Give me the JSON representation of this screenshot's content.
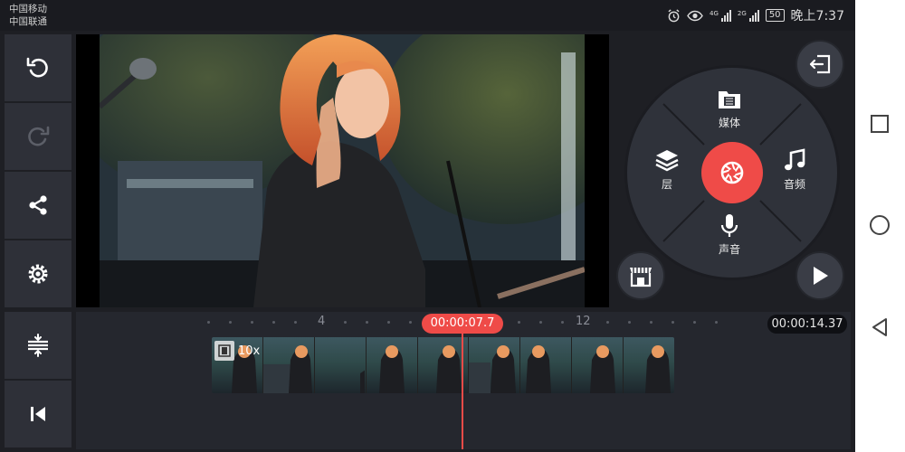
{
  "status_bar": {
    "carrier_1": "中国移动",
    "carrier_2": "中国联通",
    "net_1": "4G",
    "net_2": "2G",
    "battery": "50",
    "time": "晚上7:37"
  },
  "left_toolbar": {
    "items": [
      "undo-icon",
      "redo-icon",
      "share-icon",
      "settings-icon",
      "track-adjust-icon",
      "skip-to-start-icon"
    ]
  },
  "media_wheel": {
    "media_label": "媒体",
    "layer_label": "层",
    "audio_label": "音频",
    "voice_label": "声音"
  },
  "timeline": {
    "ruler_mark_1": "4",
    "ruler_mark_2": "12",
    "current_time": "00:00:07.7",
    "total_duration": "00:00:14.37",
    "clip_speed": "10x"
  },
  "colors": {
    "accent": "#ef4b48",
    "panel": "#2e3038",
    "background": "#1e1f24"
  }
}
